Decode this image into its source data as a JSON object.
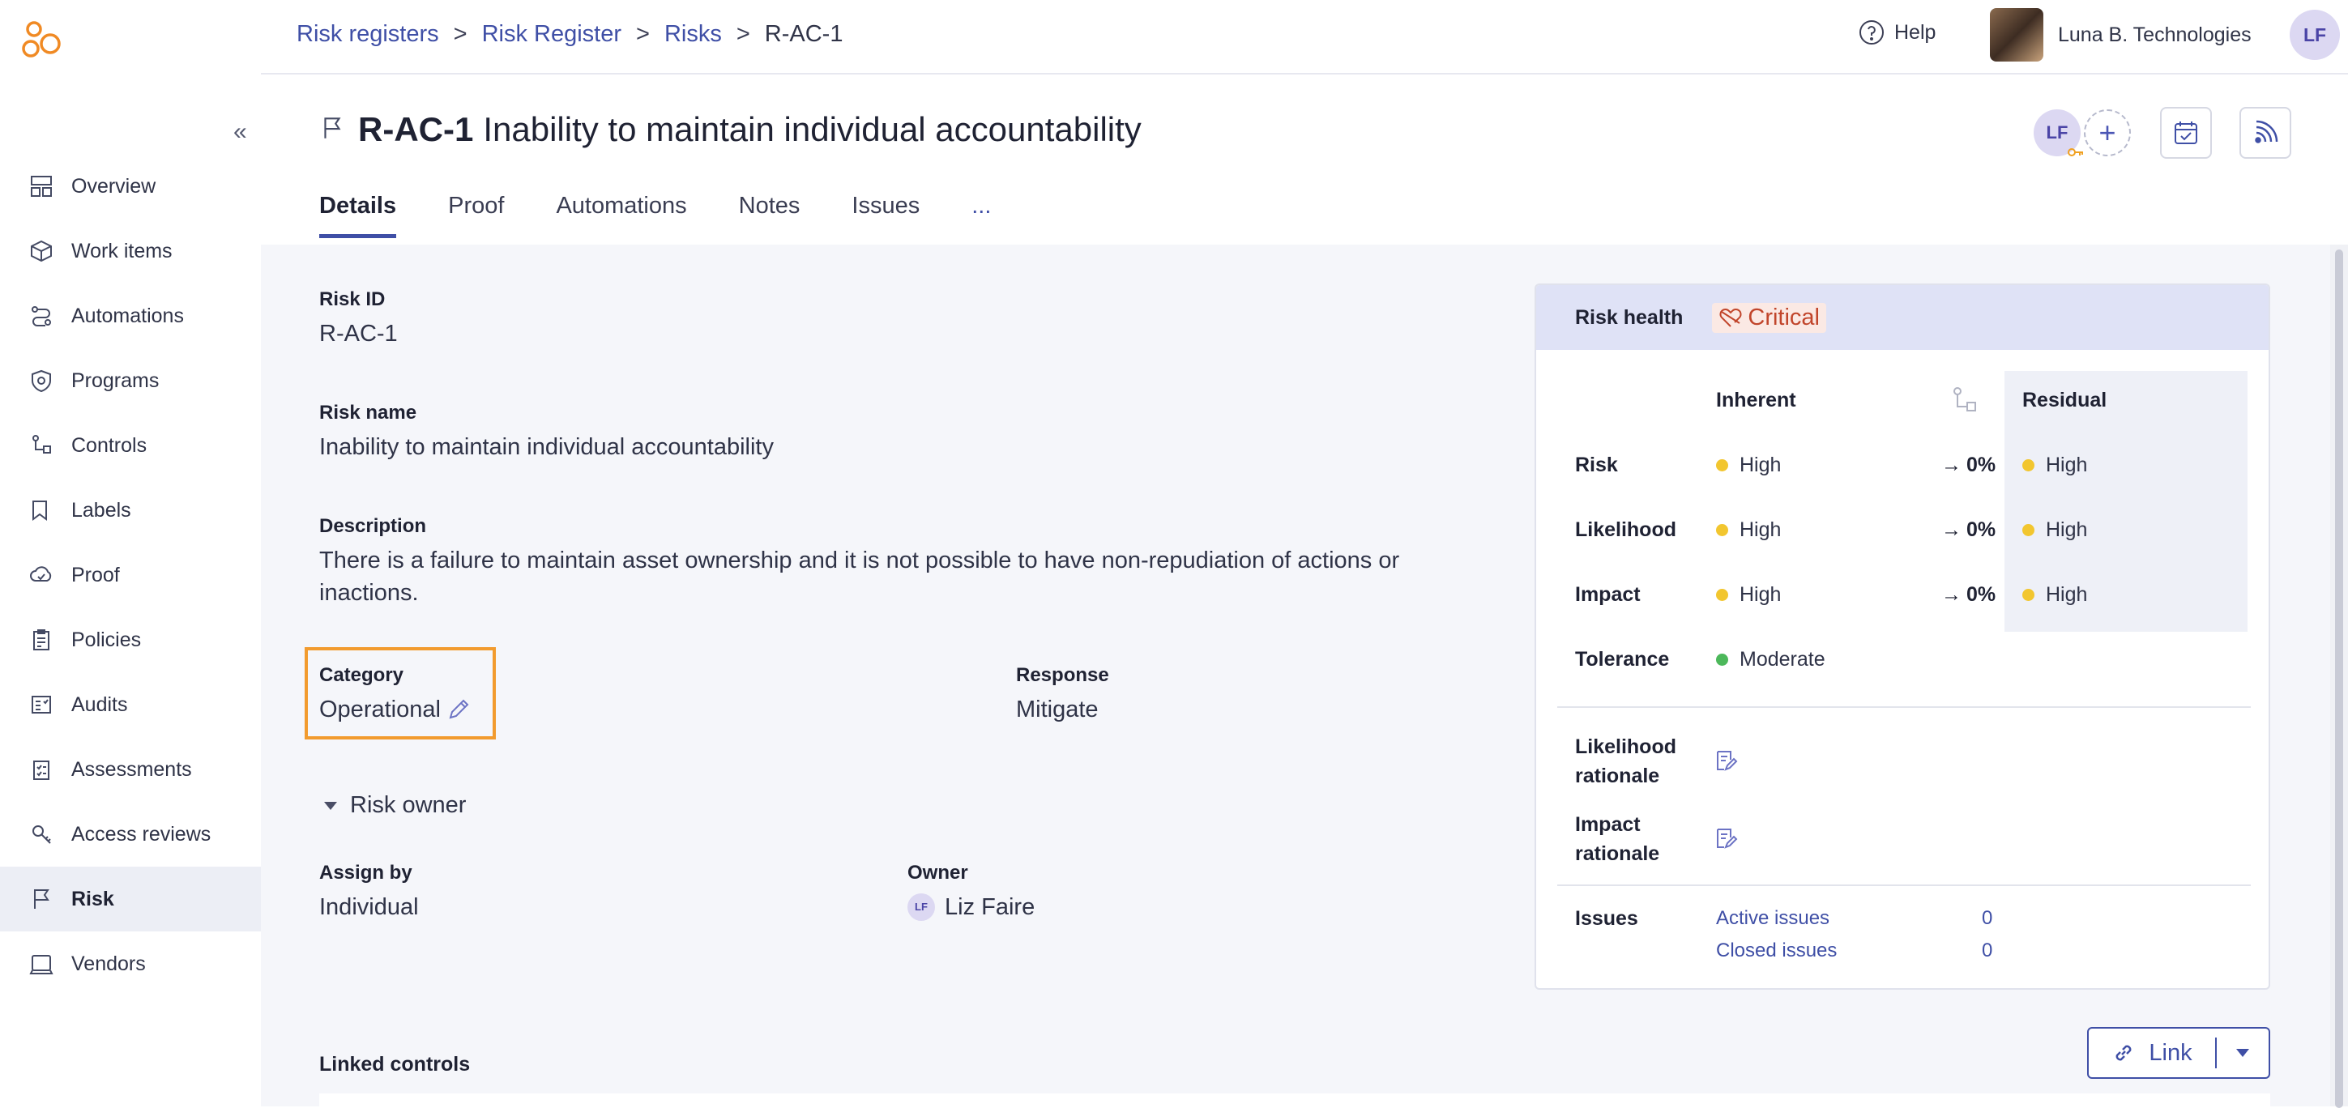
{
  "breadcrumb": [
    "Risk registers",
    "Risk Register",
    "Risks"
  ],
  "breadcrumb_sep": ">",
  "breadcrumb_current": "R-AC-1",
  "topbar": {
    "help_label": "Help",
    "org_name": "Luna B. Technologies",
    "user_initials": "LF"
  },
  "sidebar": {
    "collapse_glyph": "«",
    "items": [
      {
        "label": "Overview",
        "icon": "overview-icon"
      },
      {
        "label": "Work items",
        "icon": "work-items-icon"
      },
      {
        "label": "Automations",
        "icon": "automations-icon"
      },
      {
        "label": "Programs",
        "icon": "programs-icon"
      },
      {
        "label": "Controls",
        "icon": "controls-icon"
      },
      {
        "label": "Labels",
        "icon": "labels-icon"
      },
      {
        "label": "Proof",
        "icon": "proof-icon"
      },
      {
        "label": "Policies",
        "icon": "policies-icon"
      },
      {
        "label": "Audits",
        "icon": "audits-icon"
      },
      {
        "label": "Assessments",
        "icon": "assessments-icon"
      },
      {
        "label": "Access reviews",
        "icon": "access-reviews-icon"
      },
      {
        "label": "Risk",
        "icon": "risk-flag-icon",
        "active": true
      },
      {
        "label": "Vendors",
        "icon": "vendors-icon"
      }
    ]
  },
  "header": {
    "risk_id": "R-AC-1",
    "title": "Inability to maintain individual accountability",
    "assignee_initials": "LF",
    "add_glyph": "+"
  },
  "tabs": [
    "Details",
    "Proof",
    "Automations",
    "Notes",
    "Issues",
    "..."
  ],
  "details": {
    "risk_id_label": "Risk ID",
    "risk_id": "R-AC-1",
    "risk_name_label": "Risk name",
    "risk_name": "Inability to maintain individual accountability",
    "description_label": "Description",
    "description": "There is a failure to maintain asset ownership and it is not possible to have non-repudiation of actions or inactions.",
    "category_label": "Category",
    "category": "Operational",
    "response_label": "Response",
    "response": "Mitigate",
    "risk_owner_label": "Risk owner",
    "assign_by_label": "Assign by",
    "assign_by": "Individual",
    "owner_label": "Owner",
    "owner": "Liz Faire",
    "owner_initials": "LF"
  },
  "health": {
    "title": "Risk health",
    "status": "Critical",
    "col_inherent": "Inherent",
    "col_residual": "Residual",
    "rows": [
      {
        "label": "Risk",
        "inherent": "High",
        "change": "0%",
        "residual": "High"
      },
      {
        "label": "Likelihood",
        "inherent": "High",
        "change": "0%",
        "residual": "High"
      },
      {
        "label": "Impact",
        "inherent": "High",
        "change": "0%",
        "residual": "High"
      }
    ],
    "tolerance_label": "Tolerance",
    "tolerance": "Moderate",
    "likelihood_rationale_label": "Likelihood rationale",
    "impact_rationale_label": "Impact rationale",
    "issues_label": "Issues",
    "active_issues_label": "Active issues",
    "active_issues": "0",
    "closed_issues_label": "Closed issues",
    "closed_issues": "0",
    "colors": {
      "high": "#f2c62f",
      "moderate": "#4cb85b",
      "critical": "#c1452b"
    }
  },
  "linked_controls_label": "Linked controls",
  "link_button_label": "Link"
}
